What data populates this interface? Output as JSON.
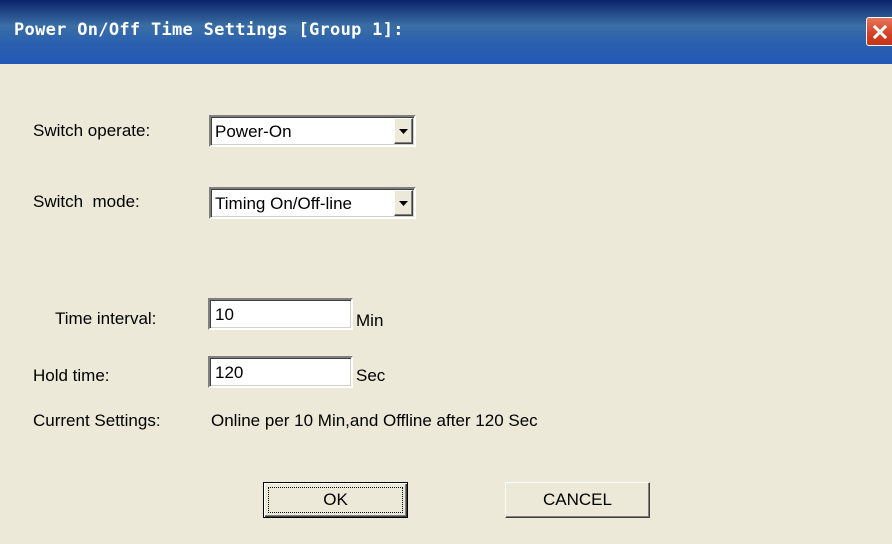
{
  "dialog": {
    "title": "Power On/Off Time Settings [Group 1]:"
  },
  "fields": {
    "switch_operate": {
      "label": "Switch operate:",
      "value": "Power-On"
    },
    "switch_mode": {
      "label": "Switch  mode:",
      "value": "Timing On/Off-line"
    },
    "time_interval": {
      "label": "Time interval:",
      "value": "10",
      "unit": "Min"
    },
    "hold_time": {
      "label": "Hold time:",
      "value": "120",
      "unit": "Sec"
    }
  },
  "current_settings": {
    "label": "Current Settings:",
    "value": "Online per 10 Min,and Offline after 120 Sec"
  },
  "buttons": {
    "ok": "OK",
    "cancel": "CANCEL"
  },
  "icons": {
    "close": "close-icon",
    "dropdown": "dropdown-arrow-icon"
  },
  "colors": {
    "titlebar": "#2458b6",
    "dialog_bg": "#ece9d8",
    "close_button": "#d5432a"
  }
}
